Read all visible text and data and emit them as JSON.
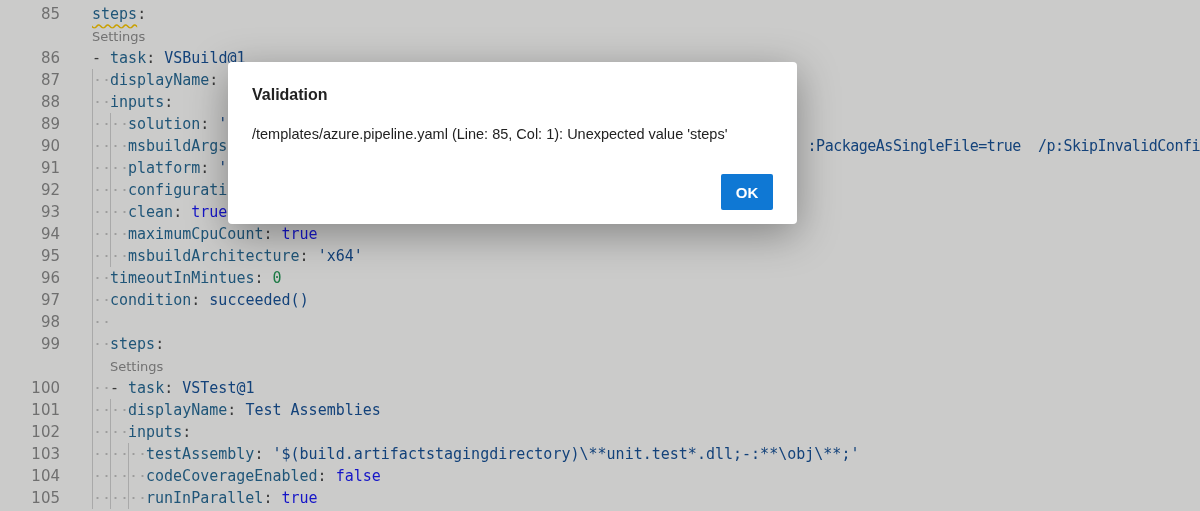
{
  "editor": {
    "lines": [
      {
        "kind": "code",
        "number": "85",
        "tokens": [
          {
            "kind": "key",
            "text": "steps",
            "warning": true
          },
          {
            "kind": "punct",
            "text": ":"
          }
        ]
      },
      {
        "kind": "codelens",
        "text": "Settings"
      },
      {
        "kind": "code",
        "number": "86",
        "tokens": [
          {
            "kind": "punct",
            "text": "- "
          },
          {
            "kind": "key",
            "text": "task"
          },
          {
            "kind": "punct",
            "text": ": "
          },
          {
            "kind": "ident",
            "text": "VSBuild@1"
          }
        ],
        "children": [
          {
            "kind": "code",
            "number": "87",
            "tokens": [
              {
                "kind": "key",
                "text": "displayName"
              },
              {
                "kind": "punct",
                "text": ":"
              }
            ]
          },
          {
            "kind": "code",
            "number": "88",
            "tokens": [
              {
                "kind": "key",
                "text": "inputs"
              },
              {
                "kind": "punct",
                "text": ":"
              }
            ],
            "children": [
              {
                "kind": "code",
                "number": "89",
                "tokens": [
                  {
                    "kind": "key",
                    "text": "solution"
                  },
                  {
                    "kind": "punct",
                    "text": ": "
                  },
                  {
                    "kind": "string",
                    "text": "'"
                  }
                ]
              },
              {
                "kind": "code",
                "number": "90",
                "tokens": [
                  {
                    "kind": "key",
                    "text": "msbuildArgs"
                  }
                ],
                "tail": [
                  {
                    "kind": "string",
                    "text": ":PackageAsSingleFile=true  /p:SkipInvalidConfi"
                  }
                ]
              },
              {
                "kind": "code",
                "number": "91",
                "tokens": [
                  {
                    "kind": "key",
                    "text": "platform"
                  },
                  {
                    "kind": "punct",
                    "text": ": "
                  },
                  {
                    "kind": "string",
                    "text": "'"
                  }
                ]
              },
              {
                "kind": "code",
                "number": "92",
                "tokens": [
                  {
                    "kind": "key",
                    "text": "configurati"
                  }
                ]
              },
              {
                "kind": "code",
                "number": "93",
                "tokens": [
                  {
                    "kind": "key",
                    "text": "clean"
                  },
                  {
                    "kind": "punct",
                    "text": ": "
                  },
                  {
                    "kind": "bool",
                    "text": "true"
                  }
                ]
              },
              {
                "kind": "code",
                "number": "94",
                "tokens": [
                  {
                    "kind": "key",
                    "text": "maximumCpuCount"
                  },
                  {
                    "kind": "punct",
                    "text": ": "
                  },
                  {
                    "kind": "bool",
                    "text": "true"
                  }
                ]
              },
              {
                "kind": "code",
                "number": "95",
                "tokens": [
                  {
                    "kind": "key",
                    "text": "msbuildArchitecture"
                  },
                  {
                    "kind": "punct",
                    "text": ": "
                  },
                  {
                    "kind": "string",
                    "text": "'x64'"
                  }
                ]
              }
            ]
          },
          {
            "kind": "code",
            "number": "96",
            "tokens": [
              {
                "kind": "key",
                "text": "timeoutInMintues"
              },
              {
                "kind": "punct",
                "text": ": "
              },
              {
                "kind": "number",
                "text": "0"
              }
            ]
          },
          {
            "kind": "code",
            "number": "97",
            "tokens": [
              {
                "kind": "key",
                "text": "condition"
              },
              {
                "kind": "punct",
                "text": ": "
              },
              {
                "kind": "ident",
                "text": "succeeded()"
              }
            ]
          },
          {
            "kind": "code",
            "number": "98"
          },
          {
            "kind": "code",
            "number": "99",
            "tokens": [
              {
                "kind": "key",
                "text": "steps"
              },
              {
                "kind": "punct",
                "text": ":"
              }
            ]
          },
          {
            "kind": "codelens",
            "text": "Settings"
          },
          {
            "kind": "code",
            "number": "100",
            "tokens": [
              {
                "kind": "punct",
                "text": "- "
              },
              {
                "kind": "key",
                "text": "task"
              },
              {
                "kind": "punct",
                "text": ": "
              },
              {
                "kind": "ident",
                "text": "VSTest@1"
              }
            ],
            "children": [
              {
                "kind": "code",
                "number": "101",
                "tokens": [
                  {
                    "kind": "key",
                    "text": "displayName"
                  },
                  {
                    "kind": "punct",
                    "text": ": "
                  },
                  {
                    "kind": "ident",
                    "text": "Test Assemblies"
                  }
                ]
              },
              {
                "kind": "code",
                "number": "102",
                "tokens": [
                  {
                    "kind": "key",
                    "text": "inputs"
                  },
                  {
                    "kind": "punct",
                    "text": ":"
                  }
                ],
                "children": [
                  {
                    "kind": "code",
                    "number": "103",
                    "tokens": [
                      {
                        "kind": "key",
                        "text": "testAssembly"
                      },
                      {
                        "kind": "punct",
                        "text": ": "
                      },
                      {
                        "kind": "string",
                        "text": "'$(build.artifactstagingdirectory)\\**unit.test*.dll;-:**\\obj\\**;'"
                      }
                    ]
                  },
                  {
                    "kind": "code",
                    "number": "104",
                    "tokens": [
                      {
                        "kind": "key",
                        "text": "codeCoverageEnabled"
                      },
                      {
                        "kind": "punct",
                        "text": ": "
                      },
                      {
                        "kind": "bool",
                        "text": "false"
                      }
                    ]
                  },
                  {
                    "kind": "code",
                    "number": "105",
                    "tokens": [
                      {
                        "kind": "key",
                        "text": "runInParallel"
                      },
                      {
                        "kind": "punct",
                        "text": ": "
                      },
                      {
                        "kind": "bool",
                        "text": "true"
                      }
                    ]
                  }
                ]
              }
            ]
          }
        ]
      }
    ]
  },
  "dialog": {
    "title": "Validation",
    "message": "/templates/azure.pipeline.yaml (Line: 85, Col: 1): Unexpected value 'steps'",
    "buttons": [
      {
        "label": "OK",
        "primary": true
      }
    ]
  }
}
